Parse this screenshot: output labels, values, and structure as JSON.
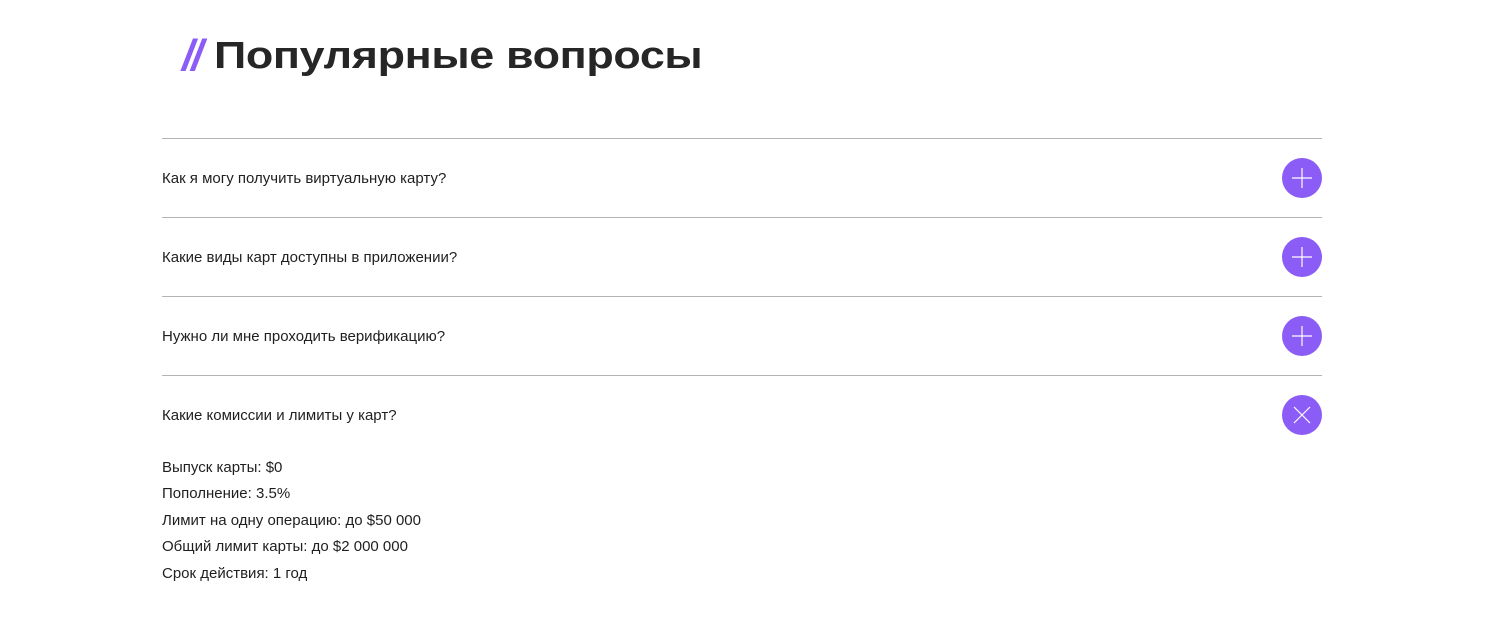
{
  "heading": {
    "slashes": "//",
    "title": "Популярные вопросы"
  },
  "colors": {
    "accent": "#8b5cf6",
    "divider": "#b4b4b4",
    "text": "#1f1f1f"
  },
  "faq": {
    "items": [
      {
        "question": "Как я могу получить виртуальную карту?",
        "expanded": false,
        "icon": "plus-icon"
      },
      {
        "question": "Какие виды карт доступны в приложении?",
        "expanded": false,
        "icon": "plus-icon"
      },
      {
        "question": "Нужно ли мне проходить верификацию?",
        "expanded": false,
        "icon": "plus-icon"
      },
      {
        "question": "Какие комиссии и лимиты у карт?",
        "expanded": true,
        "icon": "close-icon",
        "answer": [
          "Выпуск карты: $0",
          "Пополнение: 3.5%",
          "Лимит на одну операцию: до $50 000",
          "Общий лимит карты: до $2 000 000",
          "Срок действия: 1 год"
        ]
      }
    ]
  }
}
